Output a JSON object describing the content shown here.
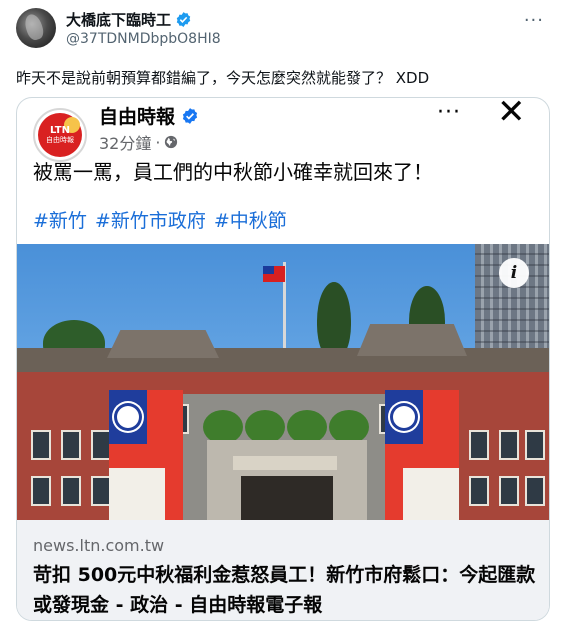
{
  "tweet": {
    "display_name": "大橋底下臨時工",
    "handle": "@37TDNMDbpbO8HI8",
    "more_label": "···",
    "text": "昨天不是說前朝預算都錯編了，今天怎麼突然就能發了？ XDD"
  },
  "card": {
    "logo_text": "LTN",
    "logo_subtext": "自由時報",
    "page_name": "自由時報",
    "timestamp": "32分鐘",
    "dot": "·",
    "more_label": "···",
    "close_label": "✕",
    "post_text": "被罵一罵，員工們的中秋節小確幸就回來了！",
    "hashtags": [
      "#新竹",
      "#新竹市政府",
      "#中秋節"
    ],
    "info_label": "i",
    "link_domain": "news.ltn.com.tw",
    "link_title": "苛扣 500元中秋福利金惹怒員工！新竹市府鬆口：今起匯款或發現金 - 政治 - 自由時報電子報"
  },
  "colors": {
    "twitter_verified": "#1d9bf0",
    "facebook_verified": "#1877f2",
    "hashtag": "#1a6ed8"
  }
}
